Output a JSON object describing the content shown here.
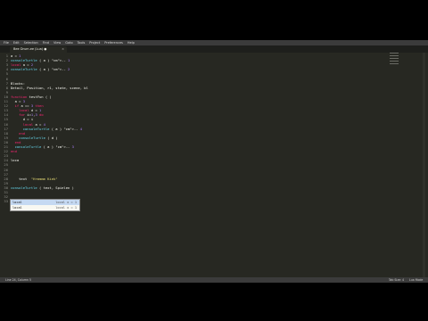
{
  "menu": [
    "File",
    "Edit",
    "Selection",
    "Find",
    "View",
    "Goto",
    "Tools",
    "Project",
    "Preferences",
    "Help"
  ],
  "tab": {
    "title": "Bee Drum.ee   (Lua) ●",
    "close": "×"
  },
  "lines": [
    {
      "n": "1",
      "code": "a = 1"
    },
    {
      "n": "2",
      "code": "consoleTurtle ( a ) -- 1"
    },
    {
      "n": "3",
      "code": "local a = 2"
    },
    {
      "n": "4",
      "code": "consoleTurtle ( a ) -- 2"
    },
    {
      "n": "5",
      "code": ""
    },
    {
      "n": "6",
      "code": ""
    },
    {
      "n": "7",
      "code": "Blocks:"
    },
    {
      "n": "8",
      "code": "Detail, Position, r1, state, scene, bl"
    },
    {
      "n": "9",
      "code": ""
    },
    {
      "n": "10",
      "code": "function testFun ( )"
    },
    {
      "n": "11",
      "code": "  a = 3"
    },
    {
      "n": "12",
      "code": "  if a == 3 then"
    },
    {
      "n": "13",
      "code": "    local d = 1"
    },
    {
      "n": "14",
      "code": "    for i=1,3 do"
    },
    {
      "n": "15",
      "code": "      d = i"
    },
    {
      "n": "16",
      "code": "      local a = 4"
    },
    {
      "n": "17",
      "code": "      consoleTurtle ( a ) -- 4"
    },
    {
      "n": "18",
      "code": "    end"
    },
    {
      "n": "19",
      "code": "    consoleTurtle ( d )"
    },
    {
      "n": "20",
      "code": "  end"
    },
    {
      "n": "21",
      "code": "  consoleTurtle ( a ) -- 3"
    },
    {
      "n": "22",
      "code": "end"
    },
    {
      "n": "23",
      "code": ""
    },
    {
      "n": "24",
      "code": "loca"
    },
    {
      "n": "25",
      "code": ""
    },
    {
      "n": "26",
      "code": ""
    },
    {
      "n": "27",
      "code": ""
    },
    {
      "n": "28",
      "code": "    text  \"Hrmmmm Kiek\""
    },
    {
      "n": "29",
      "code": ""
    },
    {
      "n": "30",
      "code": "consoleTurtle ( text, Spielen )"
    },
    {
      "n": "31",
      "code": ""
    },
    {
      "n": "32",
      "code": ""
    },
    {
      "n": "33",
      "code": ""
    }
  ],
  "autocomplete": [
    {
      "text": "local",
      "hint": "local x = 1"
    },
    {
      "text": "local",
      "hint": "local x = 1"
    }
  ],
  "minimap": [
    "#",
    "#",
    "#"
  ],
  "status": {
    "left": "Line 24, Column 5",
    "right1": "Tab Size: 4",
    "right2": "Lua Mode"
  }
}
